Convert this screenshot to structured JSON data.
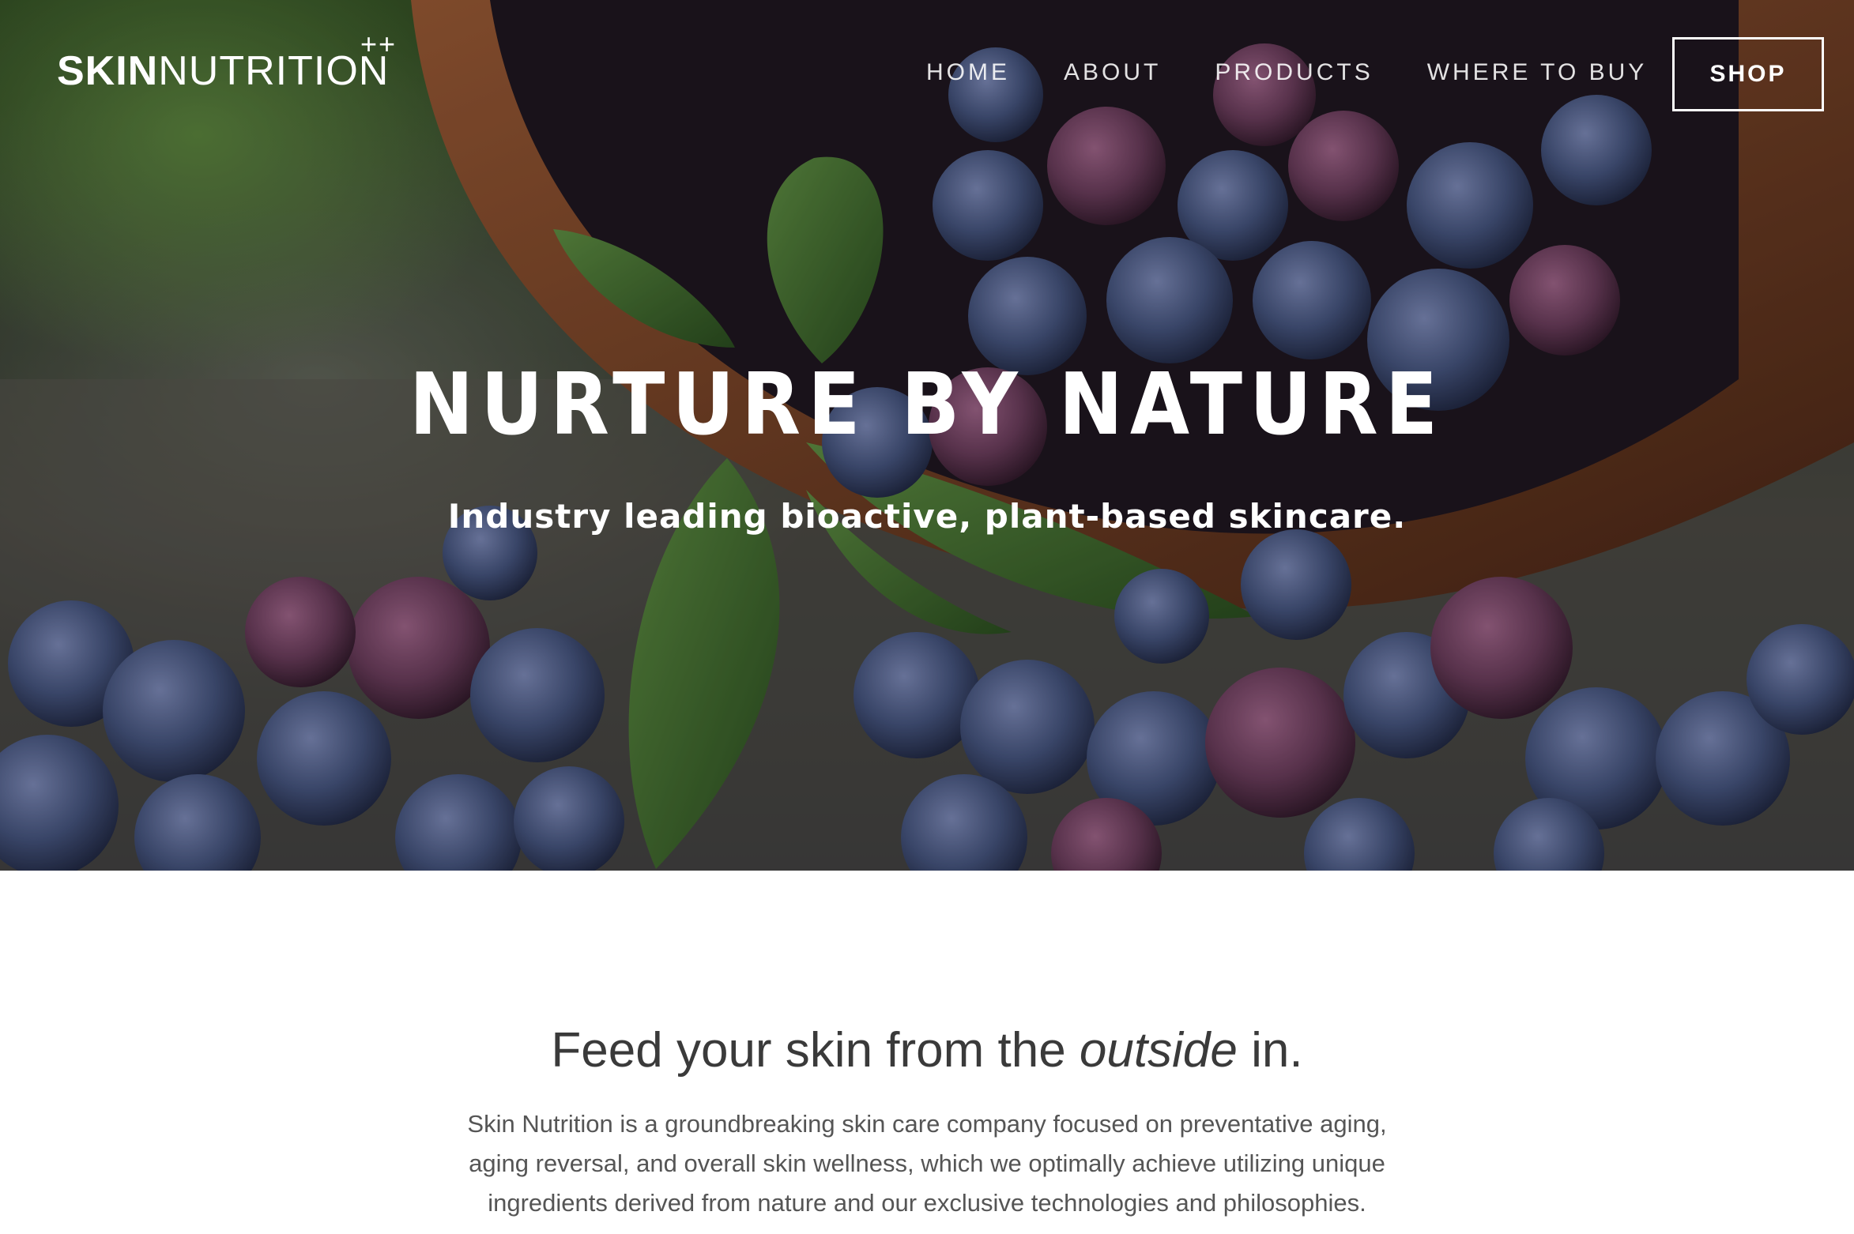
{
  "header": {
    "logo": {
      "bold": "SKIN",
      "light": "NUTRITION",
      "mark": "++"
    },
    "nav": [
      {
        "label": "HOME"
      },
      {
        "label": "ABOUT"
      },
      {
        "label": "PRODUCTS"
      },
      {
        "label": "WHERE TO BUY"
      }
    ],
    "shop_label": "SHOP"
  },
  "hero": {
    "title": "NURTURE BY NATURE",
    "subtitle": "Industry leading bioactive, plant-based skincare.",
    "image": "blueberries-basket-photo"
  },
  "content": {
    "heading_pre": "Feed your skin from the ",
    "heading_em": "outside",
    "heading_post": " in.",
    "body": "Skin Nutrition is a groundbreaking skin care company focused on preventative aging, aging reversal, and overall skin wellness, which we optimally achieve utilizing unique ingredients derived from nature and our exclusive technologies and philosophies."
  },
  "colors": {
    "heading_text": "#3a3a3a",
    "body_text": "#555555",
    "nav_text": "#ffffff",
    "berry_blue": "#3e4a75",
    "berry_purple": "#6b3d5c",
    "leaf_green": "#3f6b2e",
    "basket_brown": "#7a4327"
  }
}
